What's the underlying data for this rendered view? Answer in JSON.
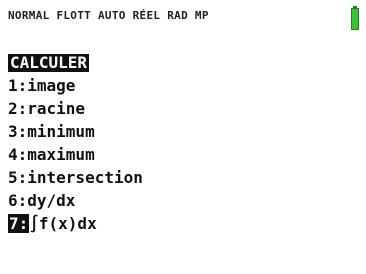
{
  "status": {
    "modes": "NORMAL FLOTT AUTO RÉEL RAD MP",
    "battery_color": "#3fbf3a"
  },
  "menu": {
    "title": "CALCULER",
    "items": [
      {
        "num": "1:",
        "label": "image"
      },
      {
        "num": "2:",
        "label": "racine"
      },
      {
        "num": "3:",
        "label": "minimum"
      },
      {
        "num": "4:",
        "label": "maximum"
      },
      {
        "num": "5:",
        "label": "intersection"
      },
      {
        "num": "6:",
        "label": "dy/dx"
      },
      {
        "num": "7:",
        "label": "∫f(x)dx"
      }
    ],
    "selected_index": 6
  }
}
